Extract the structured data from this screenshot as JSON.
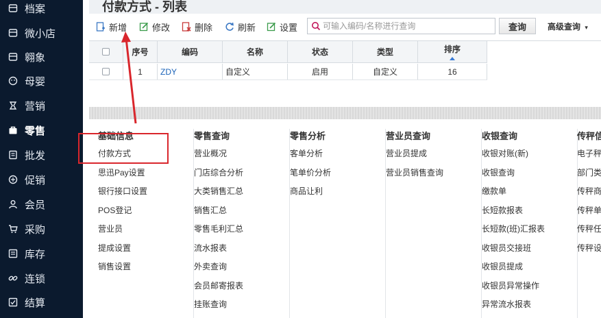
{
  "sidebar": {
    "items": [
      {
        "label": "档案",
        "icon": "archive-icon",
        "name": "sidebar-item-archive"
      },
      {
        "label": "微小店",
        "icon": "store-icon",
        "name": "sidebar-item-micro-store"
      },
      {
        "label": "翱象",
        "icon": "elephant-icon",
        "name": "sidebar-item-aoxiang"
      },
      {
        "label": "母婴",
        "icon": "baby-icon",
        "name": "sidebar-item-maternal"
      },
      {
        "label": "营销",
        "icon": "marketing-icon",
        "name": "sidebar-item-marketing"
      },
      {
        "label": "零售",
        "icon": "bag-icon",
        "name": "sidebar-item-retail",
        "active": true
      },
      {
        "label": "批发",
        "icon": "wholesale-icon",
        "name": "sidebar-item-wholesale"
      },
      {
        "label": "促销",
        "icon": "promo-icon",
        "name": "sidebar-item-promotion"
      },
      {
        "label": "会员",
        "icon": "member-icon",
        "name": "sidebar-item-member"
      },
      {
        "label": "采购",
        "icon": "cart-icon",
        "name": "sidebar-item-purchase"
      },
      {
        "label": "库存",
        "icon": "inventory-icon",
        "name": "sidebar-item-inventory"
      },
      {
        "label": "连锁",
        "icon": "chain-icon",
        "name": "sidebar-item-chain"
      },
      {
        "label": "结算",
        "icon": "settle-icon",
        "name": "sidebar-item-settlement"
      }
    ]
  },
  "page": {
    "title": "付款方式 - 列表"
  },
  "toolbar": {
    "add_label": "新增",
    "edit_label": "修改",
    "delete_label": "删除",
    "refresh_label": "刷新",
    "settings_label": "设置",
    "search_placeholder": "可输入编码/名称进行查询",
    "search_value": "",
    "query_label": "查询",
    "advanced_label": "高级查询"
  },
  "table": {
    "columns": [
      "序号",
      "编码",
      "名称",
      "状态",
      "类型",
      "排序"
    ],
    "rows": [
      {
        "index": "1",
        "code": "ZDY",
        "name": "自定义",
        "status": "启用",
        "type": "自定义",
        "sort": "16"
      }
    ]
  },
  "menu": {
    "columns": [
      {
        "title": "基础信息",
        "items": [
          "付款方式",
          "思迅Pay设置",
          "银行接口设置",
          "POS登记",
          "营业员",
          "提成设置",
          "销售设置"
        ]
      },
      {
        "title": "零售查询",
        "items": [
          "营业概况",
          "门店综合分析",
          "大类销售汇总",
          "销售汇总",
          "零售毛利汇总",
          "流水报表",
          "外卖查询",
          "会员邮寄报表",
          "挂账查询"
        ]
      },
      {
        "title": "零售分析",
        "items": [
          "客单分析",
          "笔单价分析",
          "商品让利"
        ]
      },
      {
        "title": "营业员查询",
        "items": [
          "营业员提成",
          "营业员销售查询"
        ]
      },
      {
        "title": "收银查询",
        "items": [
          "收银对账(新)",
          "收银查询",
          "缴款单",
          "长短款报表",
          "长短款(班)汇报表",
          "收银员交接班",
          "收银员提成",
          "收银员异常操作",
          "异常流水报表"
        ]
      },
      {
        "title": "传秤信",
        "items": [
          "电子秤i",
          "部门类别",
          "传秤商",
          "传秤单",
          "传秤任",
          "传秤设"
        ]
      }
    ]
  },
  "colors": {
    "sidebar_bg": "#0b1a2e",
    "annotation": "#d9262c",
    "link": "#1a62b8"
  }
}
